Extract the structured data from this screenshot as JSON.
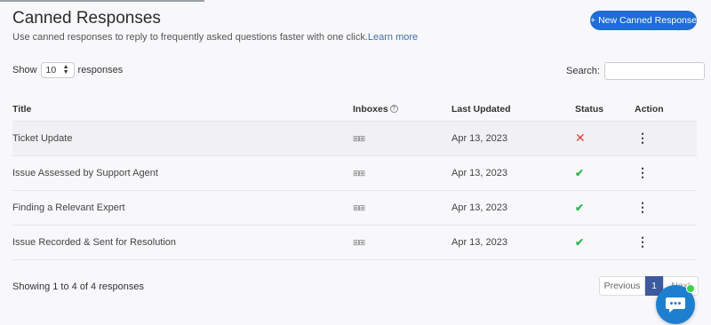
{
  "header": {
    "title": "Canned Responses",
    "subtitle": "Use canned responses to reply to frequently asked questions faster with one click.",
    "learn_more": "Learn more",
    "new_button": "+ New Canned Response"
  },
  "controls": {
    "show_label": "Show",
    "page_size": "10",
    "responses_label": "responses",
    "search_label": "Search:",
    "search_value": ""
  },
  "table": {
    "headers": {
      "title": "Title",
      "inboxes": "Inboxes",
      "last_updated": "Last Updated",
      "status": "Status",
      "action": "Action"
    },
    "rows": [
      {
        "title": "Ticket Update",
        "last_updated": "Apr 13, 2023",
        "status": "inactive"
      },
      {
        "title": "Issue Assessed by Support Agent",
        "last_updated": "Apr 13, 2023",
        "status": "active"
      },
      {
        "title": "Finding a Relevant Expert",
        "last_updated": "Apr 13, 2023",
        "status": "active"
      },
      {
        "title": "Issue Recorded & Sent for Resolution",
        "last_updated": "Apr 13, 2023",
        "status": "active"
      }
    ]
  },
  "footer": {
    "info": "Showing 1 to 4 of 4 responses",
    "previous": "Previous",
    "page": "1",
    "next": "Next"
  },
  "icons": {
    "inbox": "inbox-icon",
    "status_inactive": "x-icon",
    "status_active": "check-icon",
    "action": "kebab-menu-icon",
    "chat": "chat-bubble-icon"
  },
  "colors": {
    "primary": "#1f6dd6",
    "active_page": "#3d5a9e",
    "status_inactive": "#e04040",
    "status_active": "#2fb84f",
    "chat_online": "#3dd04a"
  }
}
